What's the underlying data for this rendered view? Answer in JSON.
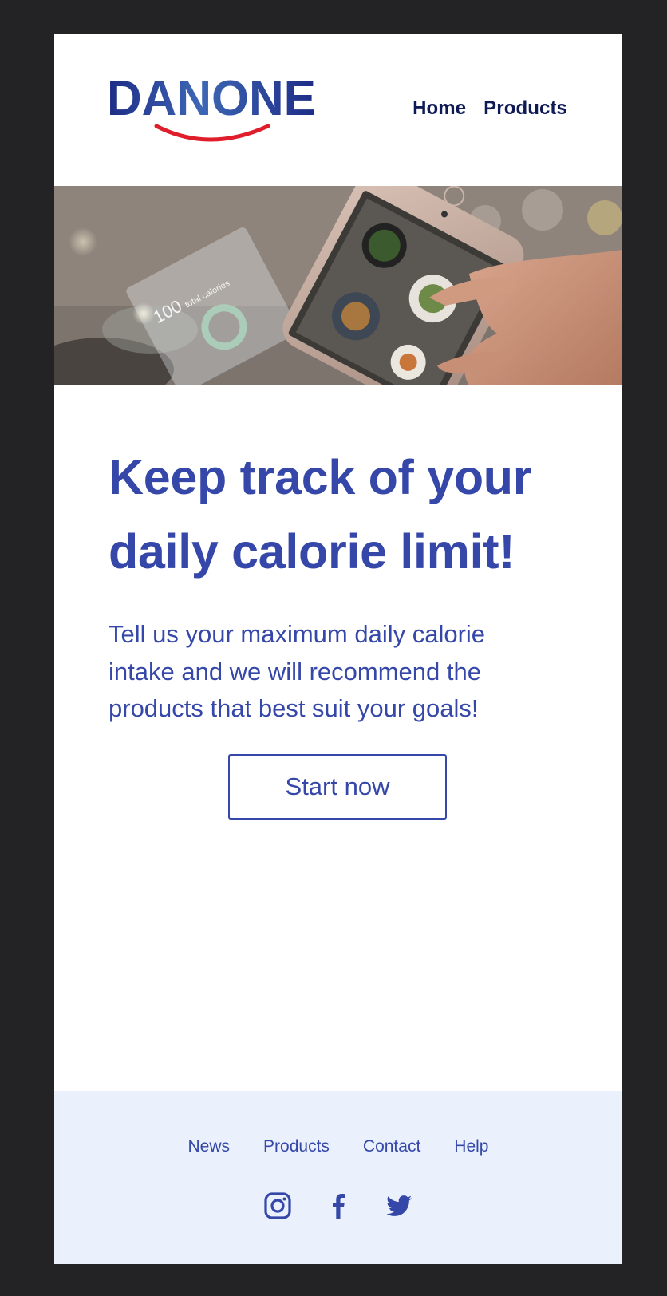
{
  "brand": {
    "name": "DANONE"
  },
  "nav": {
    "items": [
      {
        "label": "Home"
      },
      {
        "label": "Products"
      }
    ]
  },
  "hero": {
    "image": "phone-scanning-food-image",
    "overlay_value": "100",
    "overlay_caption": "total calories"
  },
  "main": {
    "headline": "Keep track of your daily calorie limit!",
    "intro": "Tell us your maximum daily calorie intake and we will recommend the products that best suit your goals!",
    "cta_label": "Start now"
  },
  "footer": {
    "links": [
      {
        "label": "News"
      },
      {
        "label": "Products"
      },
      {
        "label": "Contact"
      },
      {
        "label": "Help"
      }
    ],
    "social": [
      "instagram-icon",
      "facebook-icon",
      "twitter-icon"
    ]
  },
  "colors": {
    "page_background": "#232325",
    "brand_blue": "#3547a8",
    "nav_text": "#0e1a55",
    "logo_smile": "#e01e2b",
    "footer_background": "#eaf1fc"
  }
}
